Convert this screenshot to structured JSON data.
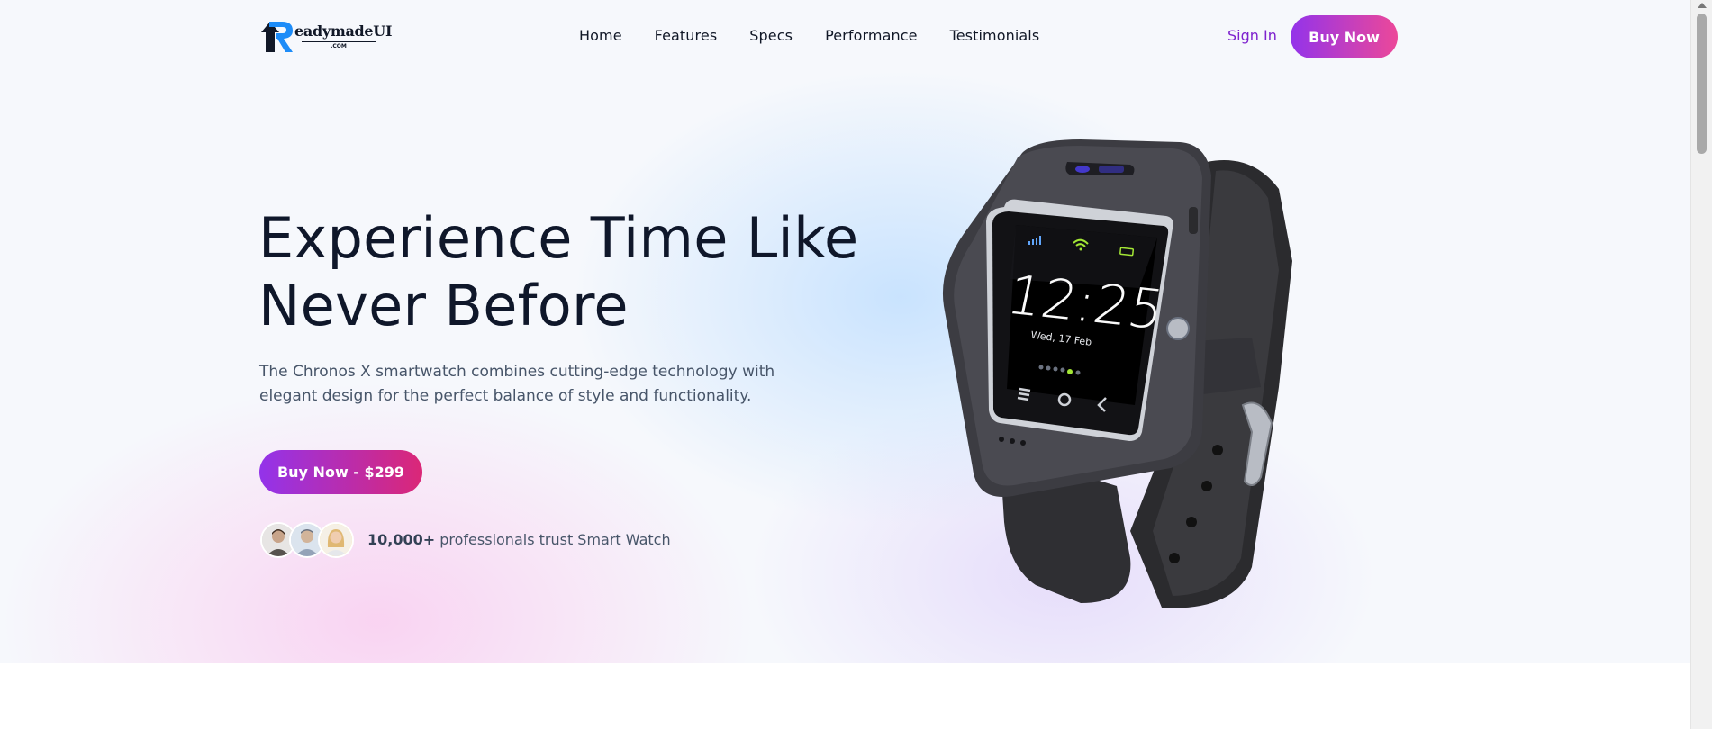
{
  "brand": {
    "logo_text": "eadymadeUI",
    "logo_sub": ".COM",
    "logo_letter": "R"
  },
  "nav": {
    "items": [
      {
        "label": "Home"
      },
      {
        "label": "Features"
      },
      {
        "label": "Specs"
      },
      {
        "label": "Performance"
      },
      {
        "label": "Testimonials"
      }
    ],
    "sign_in": "Sign In",
    "buy_now": "Buy Now"
  },
  "hero": {
    "headline_line1": "Experience Time Like",
    "headline_line2": "Never Before",
    "description": "The Chronos X smartwatch combines cutting-edge technology with elegant design for the perfect balance of style and functionality.",
    "cta": "Buy Now - $299",
    "trust_count": "10,000+",
    "trust_text": " professionals trust Smart Watch"
  },
  "watch_screen": {
    "time": "12:25",
    "date": "Wed, 17 Feb"
  },
  "colors": {
    "accent_start": "#9333ea",
    "accent_end": "#ec4899",
    "heading": "#0f172a",
    "body_text": "#475569"
  },
  "icons": [
    "logo-arrow-icon",
    "signal-icon",
    "wifi-icon",
    "battery-icon",
    "menu-icon",
    "home-circle-icon",
    "back-icon"
  ]
}
